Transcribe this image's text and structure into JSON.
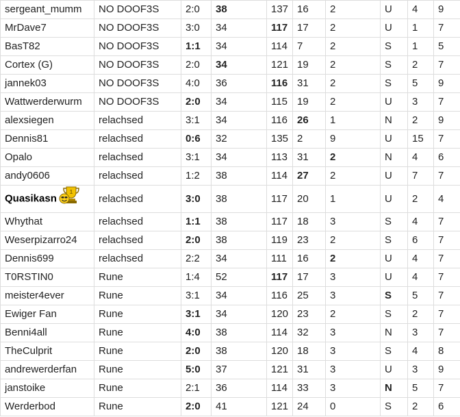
{
  "colors": {
    "highlight": "#2222dd",
    "grid": "#dddddd",
    "text": "#222222"
  },
  "rows": [
    {
      "user": "sergeant_mumm",
      "group": "NO DOOF3S",
      "tip": "2:0",
      "c4": "38",
      "c5": "137",
      "c6": "16",
      "c7": "2",
      "c8": "U",
      "c9": "4",
      "c10": "9",
      "hl": [
        "c4"
      ]
    },
    {
      "user": "MrDave7",
      "group": "NO DOOF3S",
      "tip": "3:0",
      "c4": "34",
      "c5": "117",
      "c6": "17",
      "c7": "2",
      "c8": "U",
      "c9": "1",
      "c10": "7",
      "hl": [
        "c5"
      ]
    },
    {
      "user": "BasT82",
      "group": "NO DOOF3S",
      "tip": "1:1",
      "c4": "34",
      "c5": "114",
      "c6": "7",
      "c7": "2",
      "c8": "S",
      "c9": "1",
      "c10": "5",
      "hl": [
        "tip"
      ]
    },
    {
      "user": "Cortex (G)",
      "group": "NO DOOF3S",
      "tip": "2:0",
      "c4": "34",
      "c5": "121",
      "c6": "19",
      "c7": "2",
      "c8": "S",
      "c9": "2",
      "c10": "7",
      "hl": [
        "c4"
      ]
    },
    {
      "user": "jannek03",
      "group": "NO DOOF3S",
      "tip": "4:0",
      "c4": "36",
      "c5": "116",
      "c6": "31",
      "c7": "2",
      "c8": "S",
      "c9": "5",
      "c10": "9",
      "hl": [
        "c5"
      ]
    },
    {
      "user": "Wattwerderwurm",
      "group": "NO DOOF3S",
      "tip": "2:0",
      "c4": "34",
      "c5": "115",
      "c6": "19",
      "c7": "2",
      "c8": "U",
      "c9": "3",
      "c10": "7",
      "hl": [
        "tip"
      ]
    },
    {
      "user": "alexsiegen",
      "group": "relachsed",
      "tip": "3:1",
      "c4": "34",
      "c5": "116",
      "c6": "26",
      "c7": "1",
      "c8": "N",
      "c9": "2",
      "c10": "9",
      "hl": [
        "c6"
      ]
    },
    {
      "user": "Dennis81",
      "group": "relachsed",
      "tip": "0:6",
      "c4": "32",
      "c5": "135",
      "c6": "2",
      "c7": "9",
      "c8": "U",
      "c9": "15",
      "c10": "7",
      "hl": [
        "tip"
      ]
    },
    {
      "user": "Opalo",
      "group": "relachsed",
      "tip": "3:1",
      "c4": "34",
      "c5": "113",
      "c6": "31",
      "c7": "2",
      "c8": "N",
      "c9": "4",
      "c10": "6",
      "hl": [
        "c7"
      ]
    },
    {
      "user": "andy0606",
      "group": "relachsed",
      "tip": "1:2",
      "c4": "38",
      "c5": "114",
      "c6": "27",
      "c7": "2",
      "c8": "U",
      "c9": "7",
      "c10": "7",
      "hl": [
        "c6"
      ]
    },
    {
      "user": "Quasikasn",
      "group": "relachsed",
      "tip": "3:0",
      "c4": "38",
      "c5": "117",
      "c6": "20",
      "c7": "1",
      "c8": "U",
      "c9": "2",
      "c10": "4",
      "hl": [
        "tip"
      ],
      "bold_user": true,
      "trophy": true
    },
    {
      "user": "Whythat",
      "group": "relachsed",
      "tip": "1:1",
      "c4": "38",
      "c5": "117",
      "c6": "18",
      "c7": "3",
      "c8": "S",
      "c9": "4",
      "c10": "7",
      "hl": [
        "tip"
      ]
    },
    {
      "user": "Weserpizarro24",
      "group": "relachsed",
      "tip": "2:0",
      "c4": "38",
      "c5": "119",
      "c6": "23",
      "c7": "2",
      "c8": "S",
      "c9": "6",
      "c10": "7",
      "hl": [
        "tip"
      ]
    },
    {
      "user": "Dennis699",
      "group": "relachsed",
      "tip": "2:2",
      "c4": "34",
      "c5": "111",
      "c6": "16",
      "c7": "2",
      "c8": "U",
      "c9": "4",
      "c10": "7",
      "hl": [
        "c7"
      ]
    },
    {
      "user": "T0RSTIN0",
      "group": "Rune",
      "tip": "1:4",
      "c4": "52",
      "c5": "117",
      "c6": "17",
      "c7": "3",
      "c8": "U",
      "c9": "4",
      "c10": "7",
      "hl": [
        "c5"
      ]
    },
    {
      "user": "meister4ever",
      "group": "Rune",
      "tip": "3:1",
      "c4": "34",
      "c5": "116",
      "c6": "25",
      "c7": "3",
      "c8": "S",
      "c9": "5",
      "c10": "7",
      "hl": [
        "c8"
      ]
    },
    {
      "user": "Ewiger Fan",
      "group": "Rune",
      "tip": "3:1",
      "c4": "34",
      "c5": "120",
      "c6": "23",
      "c7": "2",
      "c8": "S",
      "c9": "2",
      "c10": "7",
      "hl": [
        "tip"
      ]
    },
    {
      "user": "Benni4all",
      "group": "Rune",
      "tip": "4:0",
      "c4": "38",
      "c5": "114",
      "c6": "32",
      "c7": "3",
      "c8": "N",
      "c9": "3",
      "c10": "7",
      "hl": [
        "tip"
      ]
    },
    {
      "user": "TheCulprit",
      "group": "Rune",
      "tip": "2:0",
      "c4": "38",
      "c5": "120",
      "c6": "18",
      "c7": "3",
      "c8": "S",
      "c9": "4",
      "c10": "8",
      "hl": [
        "tip"
      ]
    },
    {
      "user": "andrewerderfan",
      "group": "Rune",
      "tip": "5:0",
      "c4": "37",
      "c5": "121",
      "c6": "31",
      "c7": "3",
      "c8": "U",
      "c9": "3",
      "c10": "9",
      "hl": [
        "tip"
      ]
    },
    {
      "user": "janstoike",
      "group": "Rune",
      "tip": "2:1",
      "c4": "36",
      "c5": "114",
      "c6": "33",
      "c7": "3",
      "c8": "N",
      "c9": "5",
      "c10": "7",
      "hl": [
        "c8"
      ]
    },
    {
      "user": "Werderbod",
      "group": "Rune",
      "tip": "2:0",
      "c4": "41",
      "c5": "121",
      "c6": "24",
      "c7": "0",
      "c8": "S",
      "c9": "2",
      "c10": "6",
      "hl": [
        "tip"
      ]
    }
  ]
}
